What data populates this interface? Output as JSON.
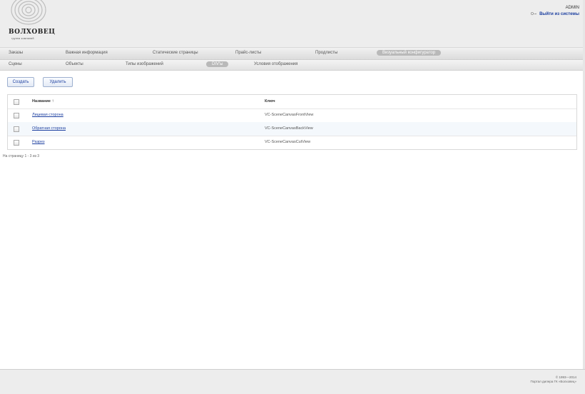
{
  "header": {
    "logo_name": "ВОЛХОВЕЦ",
    "logo_sub": "группа компаний",
    "user_name": "ADMIN",
    "logout_label": "Выйти из системы"
  },
  "main_menu": {
    "items": [
      "Заказы",
      "Важная информация",
      "Статические страницы",
      "Прайс-листы",
      "Продлисты",
      "Визуальный конфигуратор"
    ],
    "active": "Визуальный конфигуратор"
  },
  "sub_menu": {
    "items": [
      "Сцены",
      "Объекты",
      "Типы изображений",
      "DIV'ы",
      "Условия отображения"
    ],
    "active": "DIV'ы"
  },
  "toolbar": {
    "create_label": "Создать",
    "delete_label": "Удалить"
  },
  "table": {
    "columns": [
      "Название",
      "Ключ"
    ],
    "sort_indicator": "↑",
    "rows": [
      {
        "name": "Лицевая сторона",
        "key": "VC-SceneCanvasFrontView"
      },
      {
        "name": "Обратная сторона",
        "key": "VC-SceneCanvasBackView"
      },
      {
        "name": "Разрез",
        "key": "VC-SceneCanvasCutView"
      }
    ]
  },
  "pager": {
    "text": "На страницу 1 - 3 из 3"
  },
  "footer": {
    "copyright": "© 1993—2014",
    "portal": "Портал дилера ГК «Волховец»"
  }
}
